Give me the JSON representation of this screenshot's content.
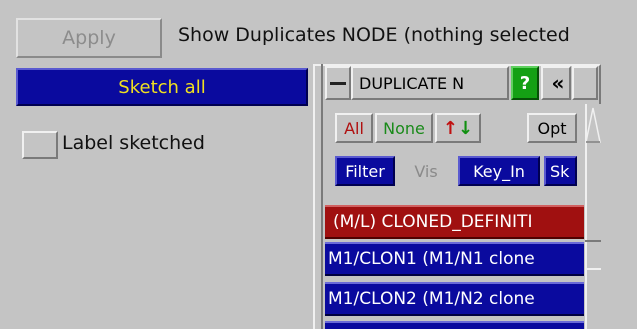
{
  "toolbar": {
    "apply_label": "Apply",
    "status_text": "Show Duplicates NODE (nothing selected"
  },
  "left_panel": {
    "sketch_all_label": "Sketch all",
    "label_sketched_text": "Label sketched",
    "label_sketched_checked": false
  },
  "duplicate_panel": {
    "title": "DUPLICATE N",
    "help_label": "?",
    "collapse_label": "«",
    "buttons": {
      "all": "All",
      "none": "None",
      "sort_up": "↑",
      "sort_down": "↓",
      "opt": "Opt",
      "filter": "Filter",
      "vis": "Vis",
      "key_in": "Key_In",
      "sk": "Sk"
    },
    "items": [
      {
        "label": "(M/L) CLONED_DEFINITI",
        "color": "#a01010"
      },
      {
        "label": "M1/CLON1 (M1/N1 clone",
        "color": "#0a0a9e"
      },
      {
        "label": "M1/CLON2 (M1/N2 clone",
        "color": "#0a0a9e"
      },
      {
        "label": "",
        "color": "#0a0a9e"
      }
    ]
  },
  "colors": {
    "background": "#c4c4c4",
    "selection_blue": "#0a0a9e",
    "highlight_red": "#a01010",
    "help_green": "#14a014",
    "sketch_text_yellow": "#f0e020"
  }
}
